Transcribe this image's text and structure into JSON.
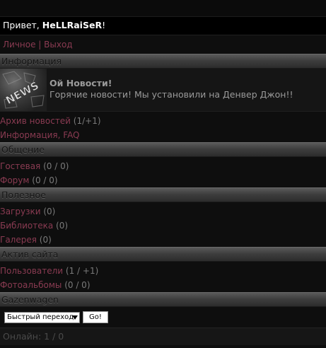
{
  "greeting": {
    "prefix": "Привет, ",
    "username": "HeLLRaiSeR",
    "suffix": "!"
  },
  "user_links": {
    "personal": "Личное",
    "separator": " | ",
    "logout": "Выход"
  },
  "sections": {
    "info": "Информация",
    "social": "Общение",
    "useful": "Полезное",
    "activity": "Актив сайта",
    "gazenwagen": "Gazenwagen"
  },
  "news": {
    "image_label": "NEWS",
    "title": "Ой Новости!",
    "text": "Горячие новости! Мы установили на Денвер Джон!!"
  },
  "info_links": [
    {
      "label": "Архив новостей",
      "count": " (1/+1)"
    },
    {
      "label": "Информация, FAQ",
      "count": ""
    }
  ],
  "social_links": [
    {
      "label": "Гостевая",
      "count": " (0 / 0)"
    },
    {
      "label": "Форум",
      "count": " (0 / 0)"
    }
  ],
  "useful_links": [
    {
      "label": "Загрузки",
      "count": " (0)"
    },
    {
      "label": "Библиотека",
      "count": " (0)"
    },
    {
      "label": "Галерея",
      "count": " (0)"
    }
  ],
  "activity_links": [
    {
      "label": "Пользователи",
      "count": " (1 / +1)"
    },
    {
      "label": "Фотоальбомы",
      "count": " (0 / 0)"
    }
  ],
  "quick_jump": {
    "selected": "Быстрый переход",
    "button": "Go!"
  },
  "online": "Онлайн: 1 / 0",
  "colors": {
    "link": "#8a3b52",
    "background": "#0e0e0e",
    "header_bar": "#3e3e3e"
  }
}
